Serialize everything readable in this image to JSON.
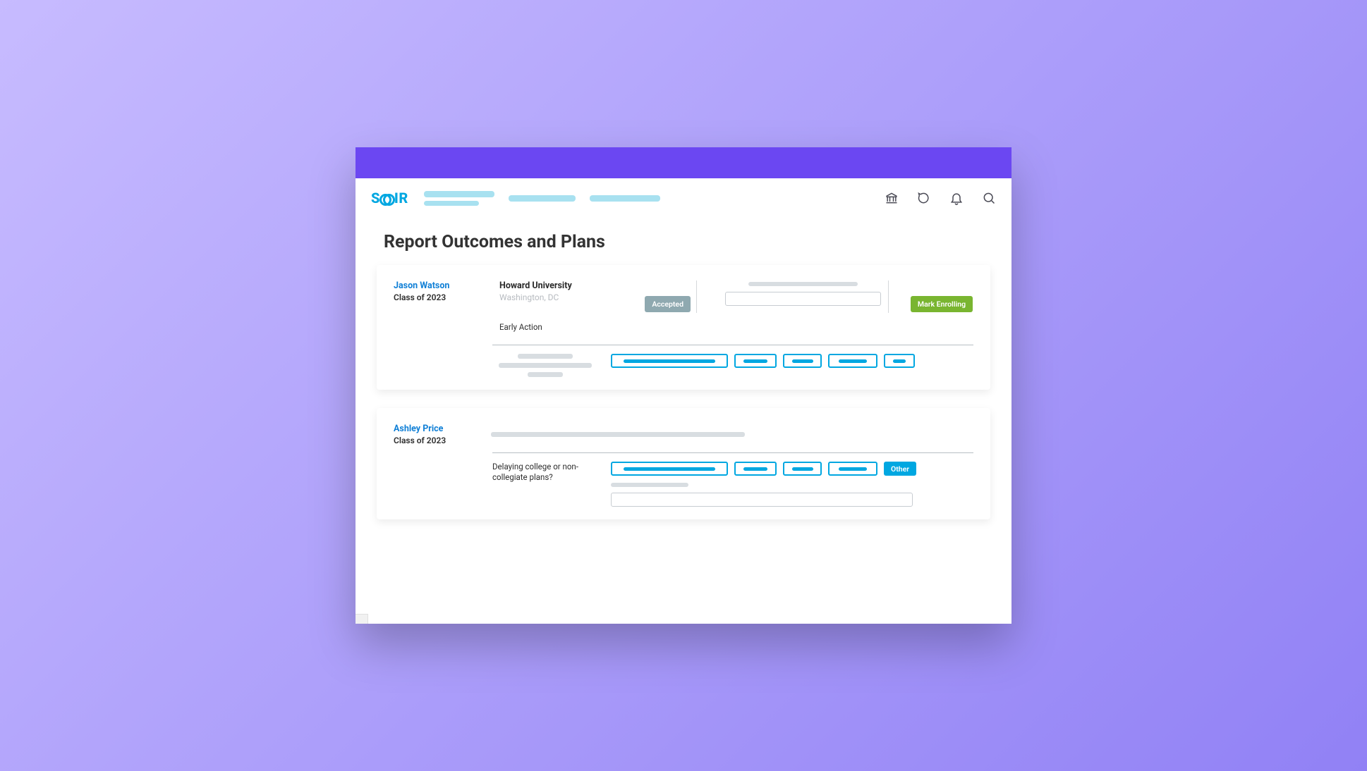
{
  "brand": {
    "name": "SCOIR",
    "left": "S",
    "right": "IR"
  },
  "page": {
    "title": "Report Outcomes and Plans"
  },
  "students": [
    {
      "name": "Jason Watson",
      "class": "Class of 2023",
      "college": {
        "name": "Howard University",
        "location": "Washington, DC"
      },
      "app_type": "Early Action",
      "status": "Accepted",
      "action": "Mark Enrolling"
    },
    {
      "name": "Ashley Price",
      "class": "Class of 2023",
      "question": "Delaying college or non-collegiate plans?",
      "other_label": "Other"
    }
  ]
}
